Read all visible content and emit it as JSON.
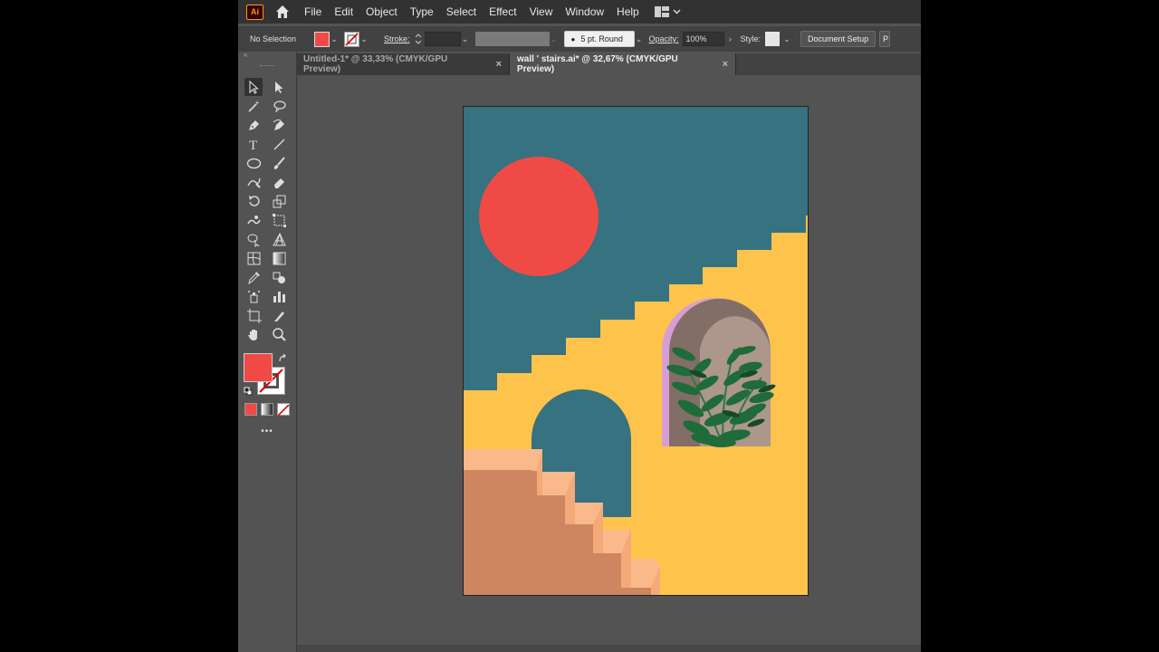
{
  "menubar": {
    "logo": "Ai",
    "items": [
      "File",
      "Edit",
      "Object",
      "Type",
      "Select",
      "Effect",
      "View",
      "Window",
      "Help"
    ]
  },
  "control": {
    "selection_label": "No Selection",
    "stroke_label": "Stroke:",
    "brush_label": "5 pt. Round",
    "opacity_label": "Opacity:",
    "opacity_value": "100%",
    "style_label": "Style:",
    "doc_setup_label": "Document Setup",
    "prefs_label": "P"
  },
  "tabs": [
    {
      "title": "Untitled-1* @ 33,33% (CMYK/GPU Preview)",
      "close": "×",
      "active": false
    },
    {
      "title": "wall ' stairs.ai* @ 32,67% (CMYK/GPU Preview)",
      "close": "×",
      "active": true
    }
  ],
  "toolbar": {
    "collapse": "«",
    "more": "•••",
    "fill_color": "#f04a47",
    "stroke_color": "#ffffff"
  },
  "colors": {
    "sky": "#36727f",
    "sun": "#f04a47",
    "wall": "#fdc34b",
    "stair_top": "#fab98b",
    "stair_side": "#cd865f",
    "arch_outline": "#d79ed3",
    "arch_inner": "#ad968b",
    "arch_shadow": "#836e67",
    "leaf": "#1f6b3a"
  }
}
